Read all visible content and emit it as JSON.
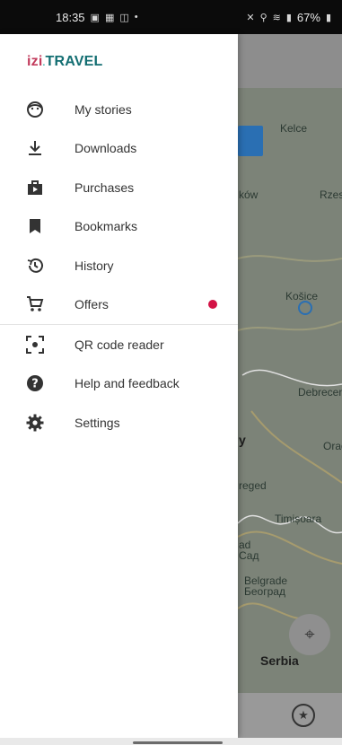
{
  "status_bar": {
    "time": "18:35",
    "left_icons": [
      "image-icon",
      "grid-icon",
      "bag-icon",
      "dot-icon"
    ],
    "right_icons": [
      "mute-icon",
      "location-pin-icon",
      "wifi-icon",
      "signal-icon"
    ],
    "battery": "67%"
  },
  "drawer": {
    "logo": {
      "izi": "izi",
      "dot": ".",
      "travel": "TRAVEL"
    },
    "items": [
      {
        "label": "My stories",
        "icon": "face-icon"
      },
      {
        "label": "Downloads",
        "icon": "download-icon"
      },
      {
        "label": "Purchases",
        "icon": "shop-bag-icon"
      },
      {
        "label": "Bookmarks",
        "icon": "bookmark-icon"
      },
      {
        "label": "History",
        "icon": "history-icon"
      },
      {
        "label": "Offers",
        "icon": "cart-icon",
        "badge": true
      }
    ],
    "secondary_items": [
      {
        "label": "QR code reader",
        "icon": "qr-scan-icon"
      },
      {
        "label": "Help and feedback",
        "icon": "help-icon"
      },
      {
        "label": "Settings",
        "icon": "gear-icon"
      }
    ]
  },
  "map": {
    "labels": [
      "Kelce",
      "ków",
      "Rzes",
      "Košice",
      "Debrecen",
      "y",
      "Orad",
      "reged",
      "Timișoara",
      "ad",
      "Сад",
      "Belgrade",
      "Београд",
      "Serbia"
    ]
  },
  "colors": {
    "accent_izi": "#c23b5c",
    "accent_travel": "#136e72",
    "badge": "#d31245"
  }
}
